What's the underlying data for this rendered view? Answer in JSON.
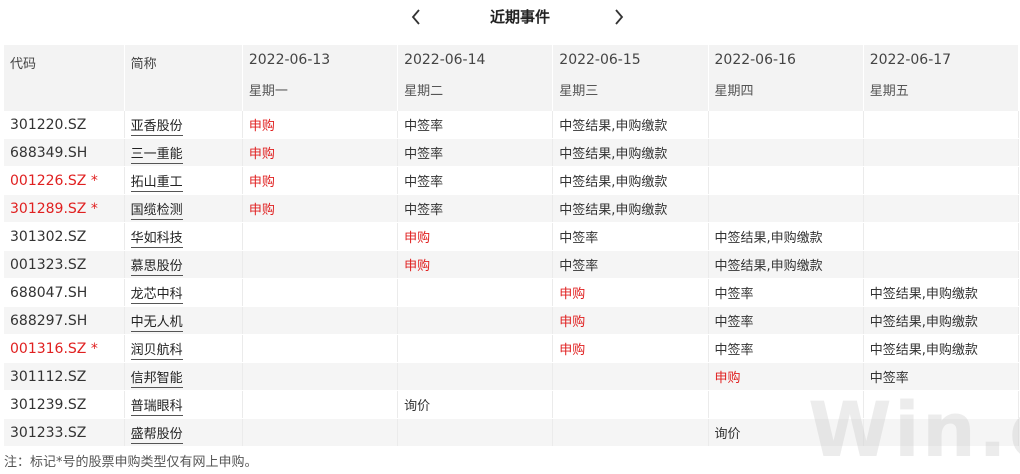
{
  "header": {
    "title": "近期事件",
    "prev_icon": "chevron-left-icon",
    "next_icon": "chevron-right-icon"
  },
  "table": {
    "col_code": "代码",
    "col_name": "简称",
    "days": [
      {
        "date": "2022-06-13",
        "weekday": "星期一"
      },
      {
        "date": "2022-06-14",
        "weekday": "星期二"
      },
      {
        "date": "2022-06-15",
        "weekday": "星期三"
      },
      {
        "date": "2022-06-16",
        "weekday": "星期四"
      },
      {
        "date": "2022-06-17",
        "weekday": "星期五"
      }
    ],
    "rows": [
      {
        "code": "301220.SZ",
        "marked": false,
        "name": "亚香股份",
        "events": [
          "申购",
          "中签率",
          "中签结果,申购缴款",
          "",
          ""
        ]
      },
      {
        "code": "688349.SH",
        "marked": false,
        "name": "三一重能",
        "events": [
          "申购",
          "中签率",
          "中签结果,申购缴款",
          "",
          ""
        ]
      },
      {
        "code": "001226.SZ *",
        "marked": true,
        "name": "拓山重工",
        "events": [
          "申购",
          "中签率",
          "中签结果,申购缴款",
          "",
          ""
        ]
      },
      {
        "code": "301289.SZ *",
        "marked": true,
        "name": "国缆检测",
        "events": [
          "申购",
          "中签率",
          "中签结果,申购缴款",
          "",
          ""
        ]
      },
      {
        "code": "301302.SZ",
        "marked": false,
        "name": "华如科技",
        "events": [
          "",
          "申购",
          "中签率",
          "中签结果,申购缴款",
          ""
        ]
      },
      {
        "code": "001323.SZ",
        "marked": false,
        "name": "慕思股份",
        "events": [
          "",
          "申购",
          "中签率",
          "中签结果,申购缴款",
          ""
        ]
      },
      {
        "code": "688047.SH",
        "marked": false,
        "name": "龙芯中科",
        "events": [
          "",
          "",
          "申购",
          "中签率",
          "中签结果,申购缴款"
        ]
      },
      {
        "code": "688297.SH",
        "marked": false,
        "name": "中无人机",
        "events": [
          "",
          "",
          "申购",
          "中签率",
          "中签结果,申购缴款"
        ]
      },
      {
        "code": "001316.SZ *",
        "marked": true,
        "name": "润贝航科",
        "events": [
          "",
          "",
          "申购",
          "中签率",
          "中签结果,申购缴款"
        ]
      },
      {
        "code": "301112.SZ",
        "marked": false,
        "name": "信邦智能",
        "events": [
          "",
          "",
          "",
          "申购",
          "中签率"
        ]
      },
      {
        "code": "301239.SZ",
        "marked": false,
        "name": "普瑞眼科",
        "events": [
          "",
          "询价",
          "",
          "",
          ""
        ]
      },
      {
        "code": "301233.SZ",
        "marked": false,
        "name": "盛帮股份",
        "events": [
          "",
          "",
          "",
          "询价",
          ""
        ]
      }
    ]
  },
  "footnote": "注：标记*号的股票申购类型仅有网上申购。",
  "watermark": "Win.d",
  "colors": {
    "highlight": "#e02020",
    "header_bg": "#f3f3f3",
    "row_alt_bg": "#f5f5f5"
  }
}
